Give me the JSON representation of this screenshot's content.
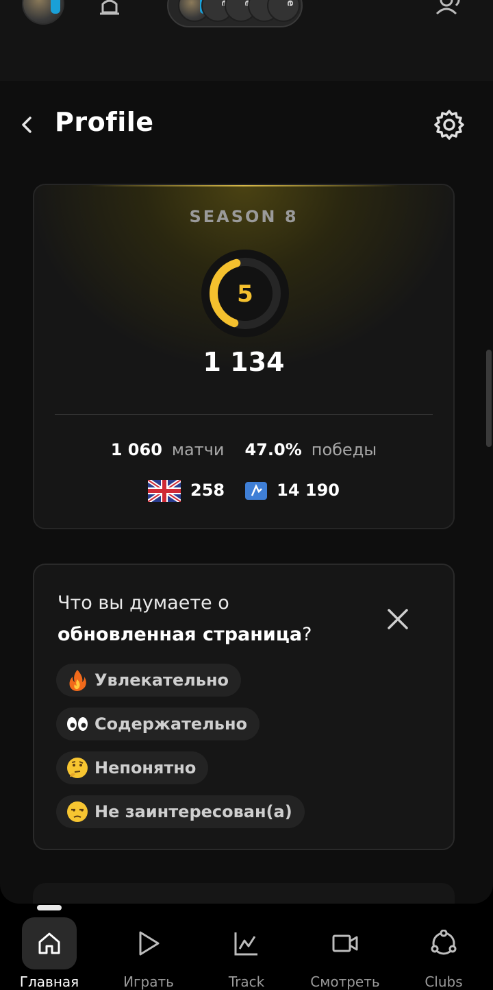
{
  "topbar": {
    "party_slots": [
      "ue",
      "ue",
      "ue",
      "ue"
    ]
  },
  "header": {
    "title": "Profile"
  },
  "season": {
    "label": "SEASON 8",
    "level": "5",
    "level_progress": 0.4,
    "elo": "1 134",
    "matches_value": "1 060",
    "matches_label": "матчи",
    "winrate_value": "47.0%",
    "winrate_label": "победы",
    "country_rank": "258",
    "region_rank": "14 190",
    "accent_color": "#f5c12e"
  },
  "feedback": {
    "question_line1": "Что вы думаете о",
    "question_line2_bold": "обновленная страница",
    "question_mark": "?",
    "options": [
      {
        "emoji": "fire-icon",
        "label": "Увлекательно"
      },
      {
        "emoji": "eyes-icon",
        "label": "Содержательно"
      },
      {
        "emoji": "thinking-face-icon",
        "label": "Непонятно"
      },
      {
        "emoji": "unamused-face-icon",
        "label": "Не заинтересован(а)"
      }
    ]
  },
  "bottom_nav": [
    {
      "label": "Главная",
      "icon": "home-icon",
      "active": true
    },
    {
      "label": "Играть",
      "icon": "play-icon",
      "active": false
    },
    {
      "label": "Track",
      "icon": "chart-icon",
      "active": false
    },
    {
      "label": "Смотреть",
      "icon": "video-icon",
      "active": false
    },
    {
      "label": "Clubs",
      "icon": "clubs-icon",
      "active": false
    }
  ]
}
